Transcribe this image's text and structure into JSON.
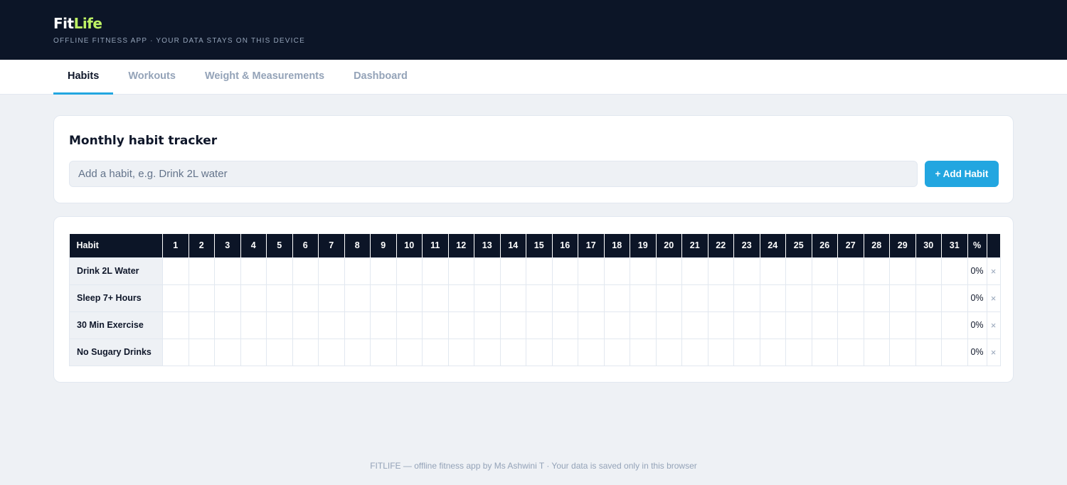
{
  "header": {
    "brand_part1": "Fit",
    "brand_part2": "Life",
    "tagline": "OFFLINE FITNESS APP · YOUR DATA STAYS ON THIS DEVICE"
  },
  "tabs": [
    {
      "label": "Habits",
      "active": true
    },
    {
      "label": "Workouts",
      "active": false
    },
    {
      "label": "Weight & Measurements",
      "active": false
    },
    {
      "label": "Dashboard",
      "active": false
    }
  ],
  "add_card": {
    "title": "Monthly habit tracker",
    "input_placeholder": "Add a habit, e.g. Drink 2L water",
    "input_value": "",
    "add_button_label": "+ Add Habit"
  },
  "tracker": {
    "habit_header": "Habit",
    "percent_header": "%",
    "days": [
      "1",
      "2",
      "3",
      "4",
      "5",
      "6",
      "7",
      "8",
      "9",
      "10",
      "11",
      "12",
      "13",
      "14",
      "15",
      "16",
      "17",
      "18",
      "19",
      "20",
      "21",
      "22",
      "23",
      "24",
      "25",
      "26",
      "27",
      "28",
      "29",
      "30",
      "31"
    ],
    "habits": [
      {
        "name": "Drink 2L Water",
        "percent": "0%"
      },
      {
        "name": "Sleep 7+ Hours",
        "percent": "0%"
      },
      {
        "name": "30 Min Exercise",
        "percent": "0%"
      },
      {
        "name": "No Sugary Drinks",
        "percent": "0%"
      }
    ],
    "delete_glyph": "×"
  },
  "footer": {
    "text": "FITLIFE — offline fitness app by Ms Ashwini T · Your data is saved only in this browser"
  },
  "colors": {
    "header_bg": "#0c1527",
    "brand_accent": "#bef264",
    "primary": "#22a6e0",
    "page_bg": "#eef1f5"
  }
}
